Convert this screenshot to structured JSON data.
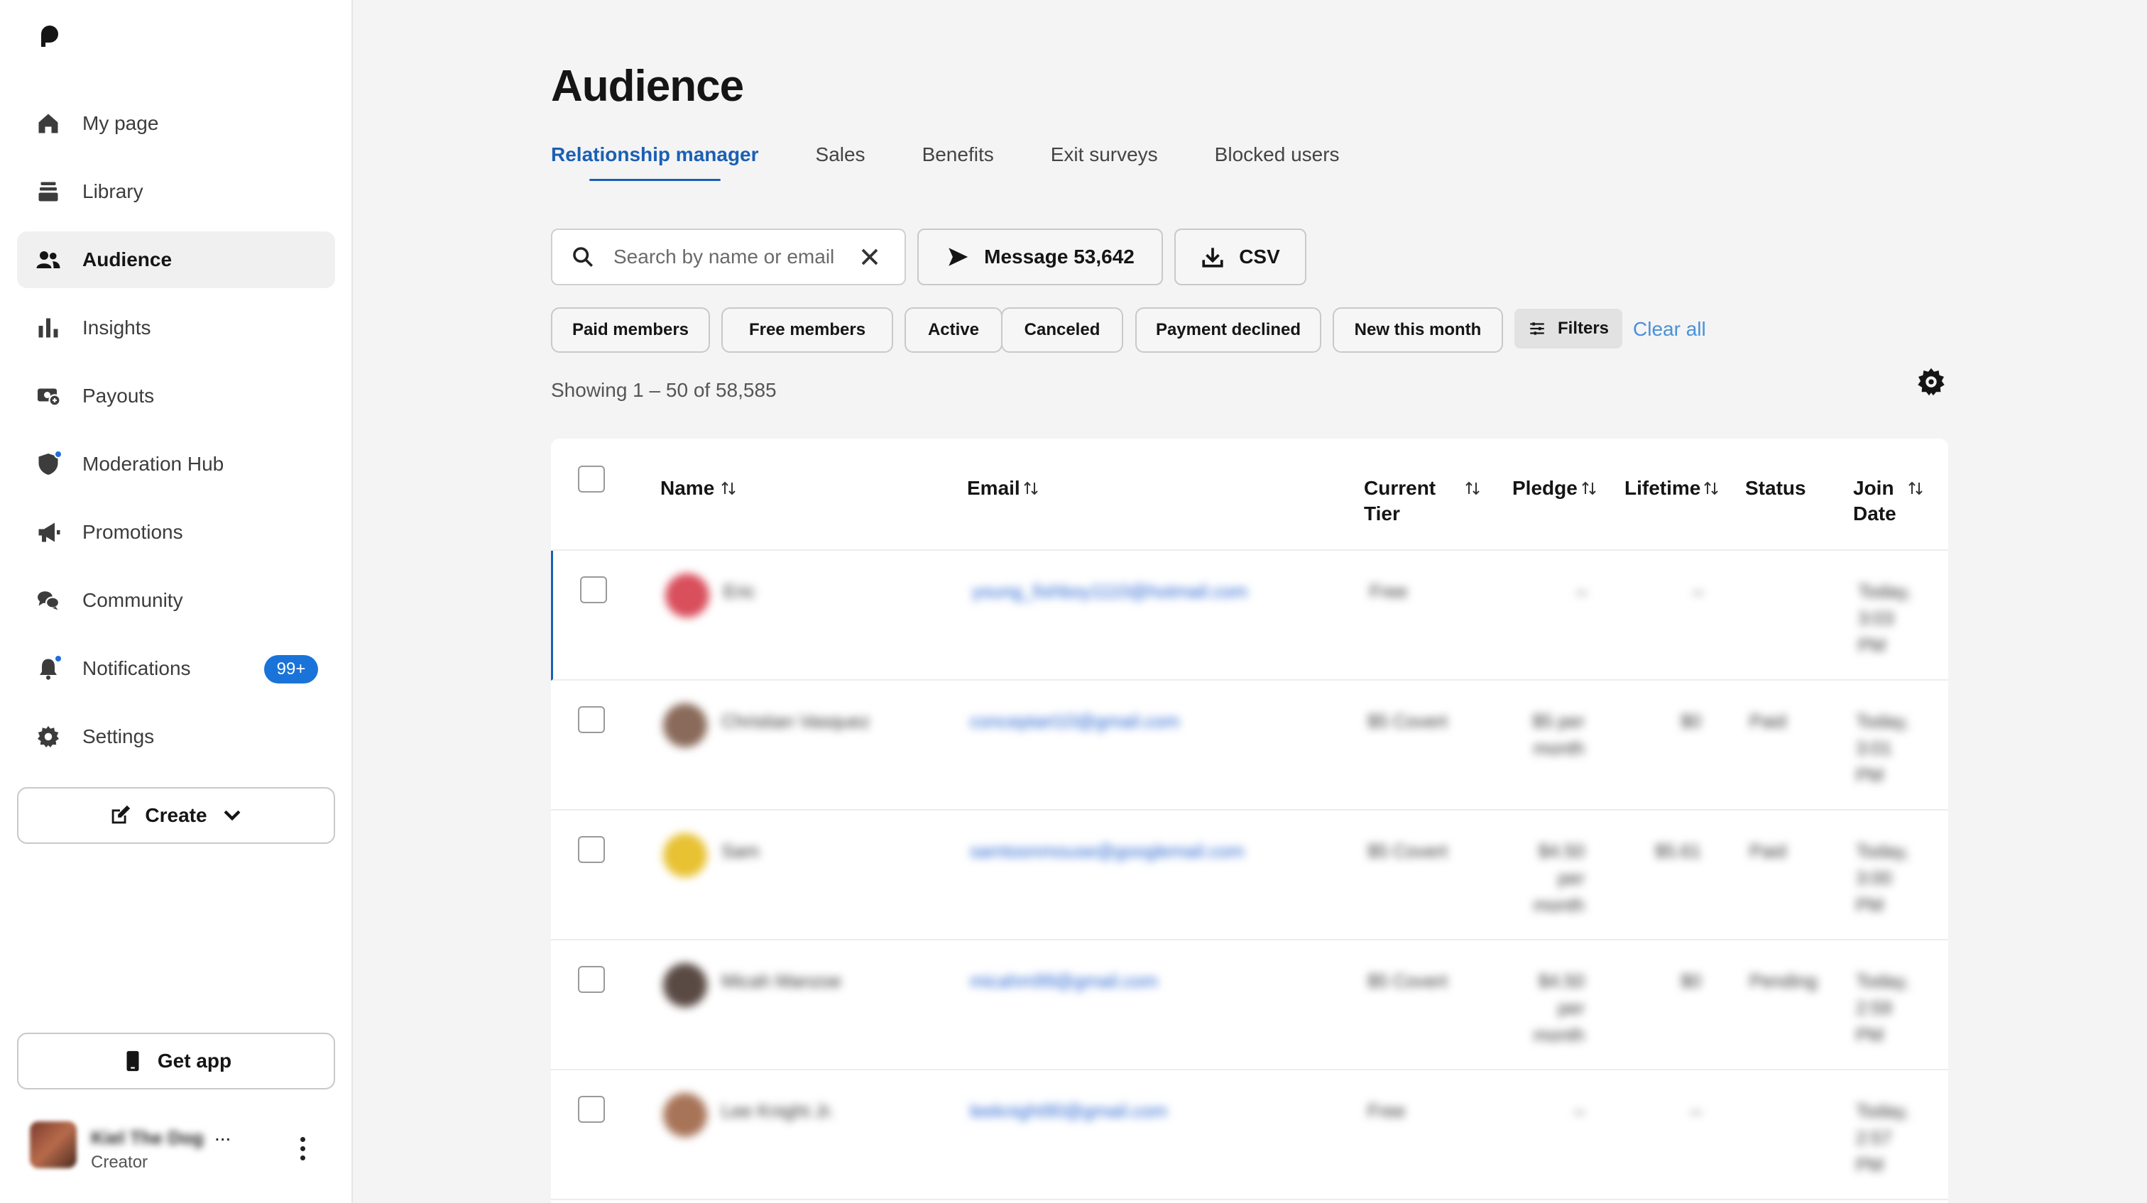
{
  "sidebar": {
    "logo": "patreon-logo-icon",
    "items": [
      {
        "label": "My page",
        "icon": "home-icon"
      },
      {
        "label": "Library",
        "icon": "library-icon"
      },
      {
        "label": "Audience",
        "icon": "people-icon",
        "active": true
      },
      {
        "label": "Insights",
        "icon": "bar-chart-icon"
      },
      {
        "label": "Payouts",
        "icon": "payout-icon"
      },
      {
        "label": "Moderation Hub",
        "icon": "shield-icon",
        "dot": true
      },
      {
        "label": "Promotions",
        "icon": "megaphone-icon"
      },
      {
        "label": "Community",
        "icon": "chat-bubbles-icon"
      },
      {
        "label": "Notifications",
        "icon": "bell-icon",
        "dot": true,
        "badge": "99+"
      },
      {
        "label": "Settings",
        "icon": "gear-icon"
      }
    ],
    "create_label": "Create",
    "get_app_label": "Get app",
    "profile": {
      "name": "Kiel The Dog",
      "ellipsis": "...",
      "role": "Creator"
    }
  },
  "main": {
    "title": "Audience",
    "tabs": [
      "Relationship manager",
      "Sales",
      "Benefits",
      "Exit surveys",
      "Blocked users"
    ],
    "active_tab": 0,
    "search": {
      "placeholder": "Search by name or email",
      "value": ""
    },
    "message_label": "Message 53,642",
    "csv_label": "CSV",
    "chips": [
      "Paid members",
      "Free members",
      "Active",
      "Canceled",
      "Payment declined",
      "New this month"
    ],
    "filters_label": "Filters",
    "clear_all_label": "Clear all",
    "showing": "Showing 1 – 50 of 58,585"
  },
  "table": {
    "headers": {
      "name": "Name",
      "email": "Email",
      "current_tier_1": "Current",
      "current_tier_2": "Tier",
      "pledge": "Pledge",
      "lifetime": "Lifetime",
      "status": "Status",
      "join_date_1": "Join",
      "join_date_2": "Date"
    },
    "rows": [
      {
        "name": "Eric",
        "email": "young_fishboy1110@hotmail.com",
        "tier": "Free",
        "pledge": "–",
        "lifetime": "–",
        "status": "",
        "join": [
          "Today,",
          "3:03",
          "PM"
        ],
        "avatar_color": "#d94f5c"
      },
      {
        "name": "Christian Vasquez",
        "email": "conceptart10@gmail.com",
        "tier": "$5 Covert",
        "pledge": [
          "$5 per",
          "month"
        ],
        "lifetime": "$0",
        "status": "Paid",
        "join": [
          "Today,",
          "3:01",
          "PM"
        ],
        "avatar_color": "#8a6a5a"
      },
      {
        "name": "Sam",
        "email": "samtoonmouse@googlemail.com",
        "tier": "$5 Covert",
        "pledge": [
          "$4.50",
          "per",
          "month"
        ],
        "lifetime": "$5.61",
        "status": "Paid",
        "join": [
          "Today,",
          "3:00",
          "PM"
        ],
        "avatar_color": "#e8c233"
      },
      {
        "name": "Micah Manzoe",
        "email": "micahm99@gmail.com",
        "tier": "$5 Covert",
        "pledge": [
          "$4.50",
          "per",
          "month"
        ],
        "lifetime": "$0",
        "status": "Pending",
        "join": [
          "Today,",
          "2:59",
          "PM"
        ],
        "avatar_color": "#5a4a44"
      },
      {
        "name": "Lee Knight Jr.",
        "email": "leeknight90@gmail.com",
        "tier": "Free",
        "pledge": "–",
        "lifetime": "–",
        "status": "",
        "join": [
          "Today,",
          "2:57",
          "PM"
        ],
        "avatar_color": "#a87458"
      }
    ]
  },
  "colors": {
    "accent": "#1a5fb4",
    "badge": "#1a73d9",
    "clear_all": "#4a90d9"
  }
}
